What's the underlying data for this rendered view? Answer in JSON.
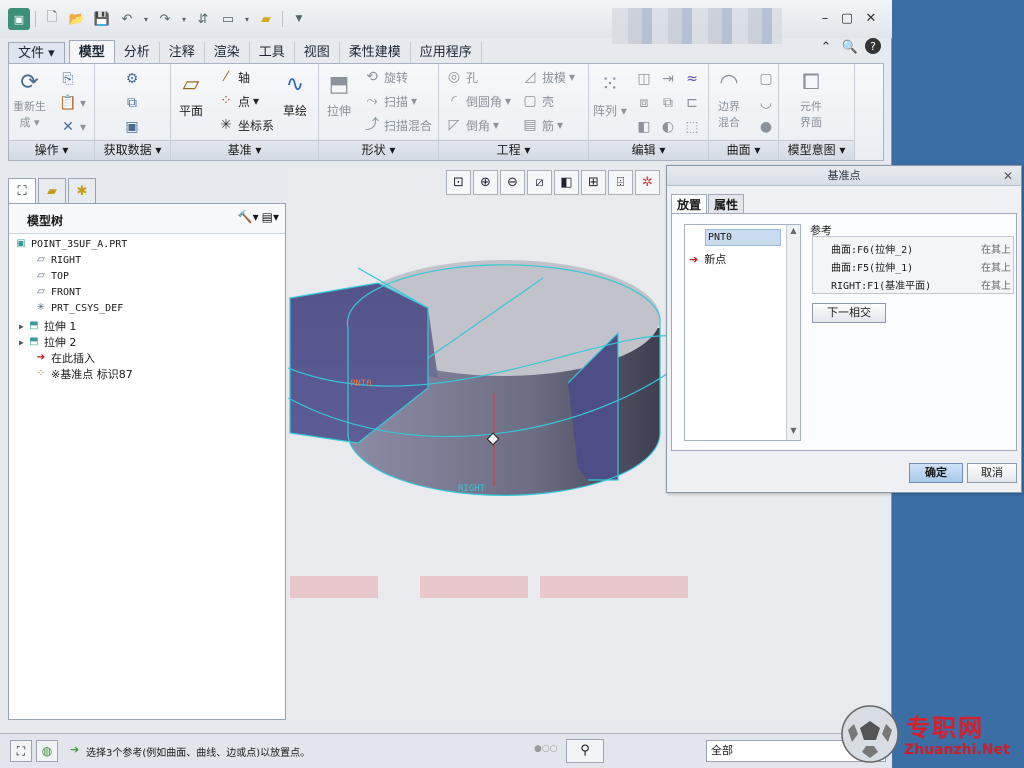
{
  "quick_access": {
    "icons": [
      "new-icon",
      "open-icon",
      "save-icon",
      "undo-icon",
      "redo-icon",
      "regenerate-icon",
      "windows-icon",
      "folder-icon",
      "customize-icon"
    ]
  },
  "ribbon_tabs": [
    "文件",
    "模型",
    "分析",
    "注释",
    "渲染",
    "工具",
    "视图",
    "柔性建模",
    "应用程序"
  ],
  "ribbon": {
    "groups": {
      "operations": "操作",
      "get_data": "获取数据",
      "datum": "基准",
      "shapes": "形状",
      "engineering": "工程",
      "editing": "编辑",
      "surfaces": "曲面",
      "model_intent": "模型意图"
    },
    "regen_line1": "重新生",
    "regen_line2": "成",
    "plane": "平面",
    "axis": "轴",
    "point": "点",
    "csys": "坐标系",
    "sketch": "草绘",
    "extrude": "拉伸",
    "revolve": "旋转",
    "sweep": "扫描",
    "swept_blend": "扫描混合",
    "hole": "孔",
    "round": "倒圆角",
    "chamfer": "倒角",
    "draft": "拔模",
    "shell": "壳",
    "rib": "筋",
    "pattern": "阵列",
    "boundary_line1": "边界",
    "boundary_line2": "混合",
    "component_line1": "元件",
    "component_line2": "界面"
  },
  "model_tree": {
    "title": "模型树",
    "nodes": [
      {
        "label": "POINT_3SUF_A.PRT",
        "icon": "part-icon"
      },
      {
        "label": "RIGHT",
        "icon": "datum-plane-icon"
      },
      {
        "label": "TOP",
        "icon": "datum-plane-icon"
      },
      {
        "label": "FRONT",
        "icon": "datum-plane-icon"
      },
      {
        "label": "PRT_CSYS_DEF",
        "icon": "csys-icon"
      },
      {
        "label": "拉伸 1",
        "icon": "extrude-icon"
      },
      {
        "label": "拉伸 2",
        "icon": "extrude-icon"
      },
      {
        "label": "在此插入",
        "icon": "insert-arrow-icon"
      },
      {
        "label": "※基准点 标识87",
        "icon": "datum-point-icon"
      }
    ]
  },
  "viewport": {
    "point_label": "PNT0",
    "plane_label": "RIGHT",
    "colors": {
      "surface": "#6a6a8c",
      "top": "#c4c4cc",
      "edge": "#35c8d8",
      "point": "#e8743a"
    }
  },
  "dialog": {
    "title": "基准点",
    "tabs": [
      "放置",
      "属性"
    ],
    "points": [
      "PNT0"
    ],
    "new_point": "新点",
    "references_label": "参考",
    "references": [
      {
        "ref": "曲面:F6(拉伸_2)",
        "constraint": "在其上"
      },
      {
        "ref": "曲面:F5(拉伸_1)",
        "constraint": "在其上"
      },
      {
        "ref": "RIGHT:F1(基准平面)",
        "constraint": "在其上"
      }
    ],
    "next_intersection": "下一相交",
    "ok": "确定",
    "cancel": "取消"
  },
  "status": {
    "message": "选择3个参考(例如曲面、曲线、边或点)以放置点。",
    "filter": "全部"
  },
  "watermark": {
    "line1": "专职网",
    "line2": "Zhuanzhi.Net"
  }
}
